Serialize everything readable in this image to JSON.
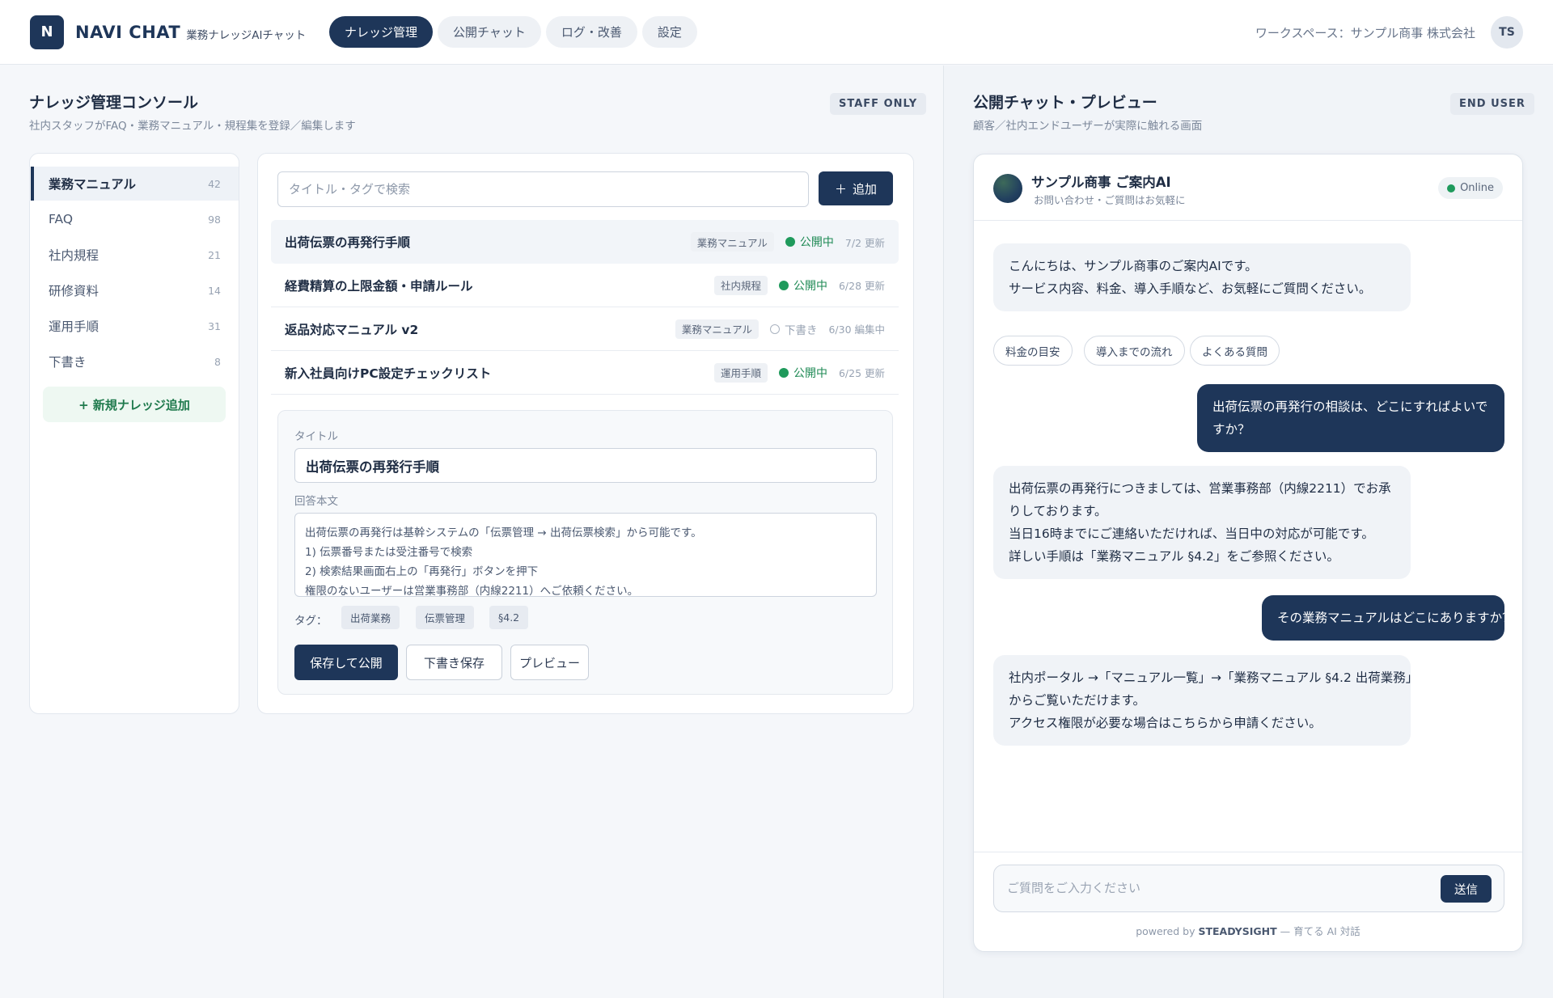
{
  "header": {
    "logo_letter": "N",
    "app_name": "NAVI CHAT",
    "app_sub": "業務ナレッジAIチャット",
    "tabs": [
      "ナレッジ管理",
      "公開チャット",
      "ログ・改善",
      "設定"
    ],
    "workspace": "ワークスペース：サンプル商事 株式会社",
    "avatar_initials": "TS"
  },
  "console": {
    "title": "ナレッジ管理コンソール",
    "subtitle": "社内スタッフがFAQ・業務マニュアル・規程集を登録／編集します",
    "badge": "STAFF ONLY",
    "sidebar": [
      {
        "label": "業務マニュアル",
        "count": "42"
      },
      {
        "label": "FAQ",
        "count": "98"
      },
      {
        "label": "社内規程",
        "count": "21"
      },
      {
        "label": "研修資料",
        "count": "14"
      },
      {
        "label": "運用手順",
        "count": "31"
      },
      {
        "label": "下書き",
        "count": "8"
      }
    ],
    "add_knowledge": "+ 新規ナレッジ追加",
    "search_placeholder": "タイトル・タグで検索",
    "add_button": "追加",
    "add_icon": "＋",
    "rows": [
      {
        "title": "出荷伝票の再発行手順",
        "tag": "業務マニュアル",
        "status": "公開中",
        "date": "7/2 更新"
      },
      {
        "title": "経費精算の上限金額・申請ルール",
        "tag": "社内規程",
        "status": "公開中",
        "date": "6/28 更新"
      },
      {
        "title": "返品対応マニュアル v2",
        "tag": "業務マニュアル",
        "status": "下書き",
        "date": "6/30 編集中"
      },
      {
        "title": "新入社員向けPC設定チェックリスト",
        "tag": "運用手順",
        "status": "公開中",
        "date": "6/25 更新"
      }
    ],
    "editor": {
      "title_label": "タイトル",
      "title_value": "出荷伝票の再発行手順",
      "body_label": "回答本文",
      "body_lines": [
        "出荷伝票の再発行は基幹システムの「伝票管理 → 出荷伝票検索」から可能です。",
        "1) 伝票番号または受注番号で検索",
        "2) 検索結果画面右上の「再発行」ボタンを押下",
        "権限のないユーザーは営業事務部（内線2211）へご依頼ください。"
      ],
      "tag_label": "タグ：",
      "tags": [
        "出荷業務",
        "伝票管理",
        "§4.2"
      ],
      "buttons": {
        "publish": "保存して公開",
        "draft": "下書き保存",
        "preview": "プレビュー"
      }
    }
  },
  "chat": {
    "title": "公開チャット・プレビュー",
    "subtitle": "顧客／社内エンドユーザーが実際に触れる画面",
    "badge": "END USER",
    "bot_name": "サンプル商事 ご案内AI",
    "bot_sub": "お問い合わせ・ご質問はお気軽に",
    "online": "Online",
    "greeting": [
      "こんにちは、サンプル商事のご案内AIです。",
      "サービス内容、料金、導入手順など、お気軽にご質問ください。"
    ],
    "quick_replies": [
      "料金の目安",
      "導入までの流れ",
      "よくある質問"
    ],
    "user_msg_1": [
      "出荷伝票の再発行の相談は、どこにすればよいで",
      "すか？"
    ],
    "bot_msg_1": [
      "出荷伝票の再発行につきましては、営業事務部（内線2211）でお承",
      "りしております。",
      "当日16時までにご連絡いただければ、当日中の対応が可能です。",
      "詳しい手順は「業務マニュアル §4.2」をご参照ください。"
    ],
    "user_msg_2": "その業務マニュアルはどこにありますか？",
    "bot_msg_2": [
      "社内ポータル →「マニュアル一覧」→「業務マニュアル §4.2 出荷業務」",
      "からご覧いただけます。",
      "アクセス権限が必要な場合はこちらから申請ください。"
    ],
    "input_placeholder": "ご質問をご入力ください",
    "send": "送信",
    "powered_prefix": "powered by",
    "powered_brand": "STEADYSIGHT",
    "powered_suffix": "— 育てる AI 対話"
  }
}
